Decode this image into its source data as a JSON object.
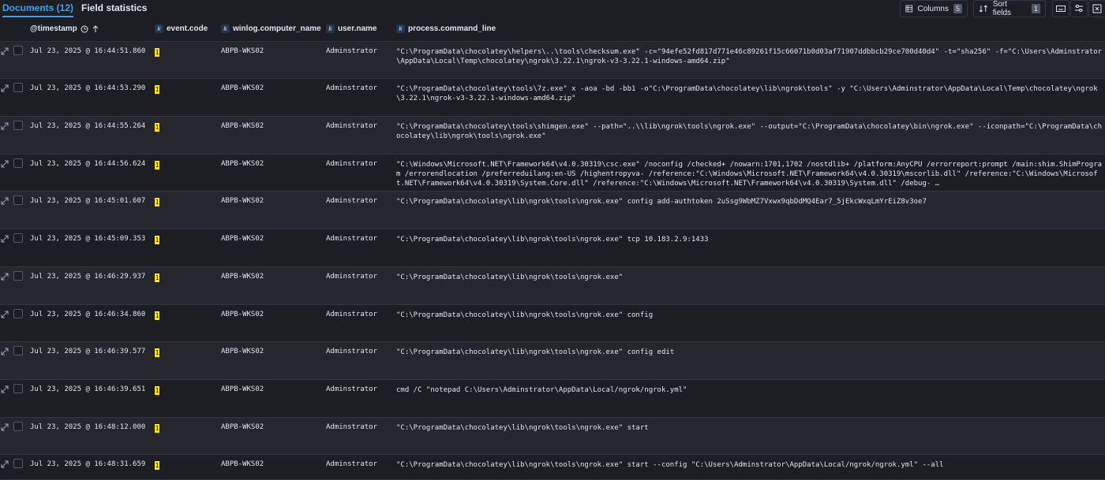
{
  "tabs": {
    "documents": "Documents (12)",
    "field_statistics": "Field statistics"
  },
  "toolbar": {
    "columns_label": "Columns",
    "columns_count": "5",
    "sort_label": "Sort fields",
    "sort_count": "1"
  },
  "columns": {
    "timestamp": "@timestamp",
    "event_code": "event.code",
    "computer_name": "winlog.computer_name",
    "user_name": "user.name",
    "command_line": "process.command_line"
  },
  "rows": [
    {
      "ts": "Jul 23, 2025 @ 16:44:51.860",
      "code": "1",
      "host": "ABPB-WKS02",
      "user": "Adminstrator",
      "cmd": "\"C:\\ProgramData\\chocolatey\\helpers\\..\\tools\\checksum.exe\" -c=\"94efe52fd817d771e46c89261f15c66071b0d03af71907ddbbcb29ce700d40d4\" -t=\"sha256\" -f=\"C:\\Users\\Adminstrator\\AppData\\Local\\Temp\\chocolatey\\ngrok\\3.22.1\\ngrok-v3-3.22.1-windows-amd64.zip\""
    },
    {
      "ts": "Jul 23, 2025 @ 16:44:53.290",
      "code": "1",
      "host": "ABPB-WKS02",
      "user": "Adminstrator",
      "cmd": "\"C:\\ProgramData\\chocolatey\\tools\\7z.exe\" x -aoa -bd -bb1 -o\"C:\\ProgramData\\chocolatey\\lib\\ngrok\\tools\" -y \"C:\\Users\\Adminstrator\\AppData\\Local\\Temp\\chocolatey\\ngrok\\3.22.1\\ngrok-v3-3.22.1-windows-amd64.zip\""
    },
    {
      "ts": "Jul 23, 2025 @ 16:44:55.264",
      "code": "1",
      "host": "ABPB-WKS02",
      "user": "Adminstrator",
      "cmd": "\"C:\\ProgramData\\chocolatey\\tools\\shimgen.exe\" --path=\"..\\\\lib\\ngrok\\tools\\ngrok.exe\" --output=\"C:\\ProgramData\\chocolatey\\bin\\ngrok.exe\"  --iconpath=\"C:\\ProgramData\\chocolatey\\lib\\ngrok\\tools\\ngrok.exe\""
    },
    {
      "ts": "Jul 23, 2025 @ 16:44:56.624",
      "code": "1",
      "host": "ABPB-WKS02",
      "user": "Adminstrator",
      "cmd": "\"C:\\Windows\\Microsoft.NET\\Framework64\\v4.0.30319\\csc.exe\" /noconfig /checked+ /nowarn:1701,1702 /nostdlib+ /platform:AnyCPU /errorreport:prompt /main:shim.ShimProgram /errorendlocation /preferreduilang:en-US /highentropyva- /reference:\"C:\\Windows\\Microsoft.NET\\Framework64\\v4.0.30319\\mscorlib.dll\" /reference:\"C:\\Windows\\Microsoft.NET\\Framework64\\v4.0.30319\\System.Core.dll\" /reference:\"C:\\Windows\\Microsoft.NET\\Framework64\\v4.0.30319\\System.dll\" /debug- …"
    },
    {
      "ts": "Jul 23, 2025 @ 16:45:01.607",
      "code": "1",
      "host": "ABPB-WKS02",
      "user": "Adminstrator",
      "cmd": "\"C:\\ProgramData\\chocolatey\\lib\\ngrok\\tools\\ngrok.exe\" config add-authtoken 2uSsg9WbMZ7Vxwx9qbDdMQ4Ear7_5jEkcWxqLmYrEiZ8v3oe7"
    },
    {
      "ts": "Jul 23, 2025 @ 16:45:09.353",
      "code": "1",
      "host": "ABPB-WKS02",
      "user": "Adminstrator",
      "cmd": "\"C:\\ProgramData\\chocolatey\\lib\\ngrok\\tools\\ngrok.exe\" tcp 10.183.2.9:1433"
    },
    {
      "ts": "Jul 23, 2025 @ 16:46:29.937",
      "code": "1",
      "host": "ABPB-WKS02",
      "user": "Adminstrator",
      "cmd": "\"C:\\ProgramData\\chocolatey\\lib\\ngrok\\tools\\ngrok.exe\""
    },
    {
      "ts": "Jul 23, 2025 @ 16:46:34.860",
      "code": "1",
      "host": "ABPB-WKS02",
      "user": "Adminstrator",
      "cmd": "\"C:\\ProgramData\\chocolatey\\lib\\ngrok\\tools\\ngrok.exe\" config"
    },
    {
      "ts": "Jul 23, 2025 @ 16:46:39.577",
      "code": "1",
      "host": "ABPB-WKS02",
      "user": "Adminstrator",
      "cmd": "\"C:\\ProgramData\\chocolatey\\lib\\ngrok\\tools\\ngrok.exe\" config edit"
    },
    {
      "ts": "Jul 23, 2025 @ 16:46:39.651",
      "code": "1",
      "host": "ABPB-WKS02",
      "user": "Adminstrator",
      "cmd": "cmd /C \"notepad C:\\Users\\Adminstrator\\AppData\\Local/ngrok/ngrok.yml\""
    },
    {
      "ts": "Jul 23, 2025 @ 16:48:12.000",
      "code": "1",
      "host": "ABPB-WKS02",
      "user": "Adminstrator",
      "cmd": "\"C:\\ProgramData\\chocolatey\\lib\\ngrok\\tools\\ngrok.exe\" start"
    },
    {
      "ts": "Jul 23, 2025 @ 16:48:31.659",
      "code": "1",
      "host": "ABPB-WKS02",
      "user": "Adminstrator",
      "cmd": "\"C:\\ProgramData\\chocolatey\\lib\\ngrok\\tools\\ngrok.exe\" start --config \"C:\\Users\\Adminstrator\\AppData\\Local/ngrok/ngrok.yml\" --all"
    }
  ]
}
